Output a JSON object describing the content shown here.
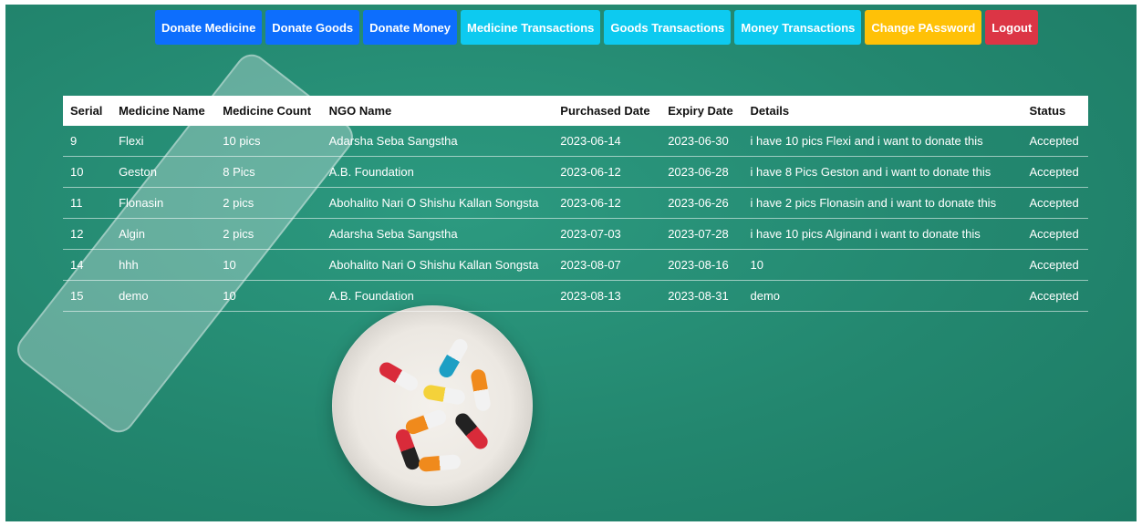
{
  "nav": {
    "buttons": [
      {
        "label": "Donate Medicine",
        "style": "primary"
      },
      {
        "label": "Donate Goods",
        "style": "primary"
      },
      {
        "label": "Donate Money",
        "style": "primary"
      },
      {
        "label": "Medicine Transactions",
        "style": "info"
      },
      {
        "label": "Goods Transactions",
        "style": "info"
      },
      {
        "label": "Money Transactions",
        "style": "info"
      },
      {
        "label": "Change PAssword",
        "style": "warning"
      },
      {
        "label": "Logout",
        "style": "danger"
      }
    ]
  },
  "table": {
    "headers": [
      "Serial",
      "Medicine Name",
      "Medicine Count",
      "NGO Name",
      "Purchased Date",
      "Expiry Date",
      "Details",
      "Status"
    ],
    "rows": [
      [
        "9",
        "Flexi",
        "10 pics",
        "Adarsha Seba Sangstha",
        "2023-06-14",
        "2023-06-30",
        "i have 10 pics Flexi and i want to donate this",
        "Accepted"
      ],
      [
        "10",
        "Geston",
        "8 Pics",
        "A.B. Foundation",
        "2023-06-12",
        "2023-06-28",
        "i have 8 Pics Geston and i want to donate this",
        "Accepted"
      ],
      [
        "11",
        "Flonasin",
        "2 pics",
        "Abohalito Nari O Shishu Kallan Songsta",
        "2023-06-12",
        "2023-06-26",
        "i have 2 pics Flonasin and i want to donate this",
        "Accepted"
      ],
      [
        "12",
        "Algin",
        "2 pics",
        "Adarsha Seba Sangstha",
        "2023-07-03",
        "2023-07-28",
        "i have 10 pics Alginand i want to donate this",
        "Accepted"
      ],
      [
        "14",
        "hhh",
        "10",
        "Abohalito Nari O Shishu Kallan Songsta",
        "2023-08-07",
        "2023-08-16",
        "10",
        "Accepted"
      ],
      [
        "15",
        "demo",
        "10",
        "A.B. Foundation",
        "2023-08-13",
        "2023-08-31",
        "demo",
        "Accepted"
      ]
    ]
  },
  "colors": {
    "background": "#23876f",
    "primary": "#0d6efd",
    "info": "#0dcaf0",
    "warning": "#ffc107",
    "danger": "#dc3545"
  },
  "decor": {
    "background_image": "pill-organizer-and-pill-bowl-photo"
  }
}
